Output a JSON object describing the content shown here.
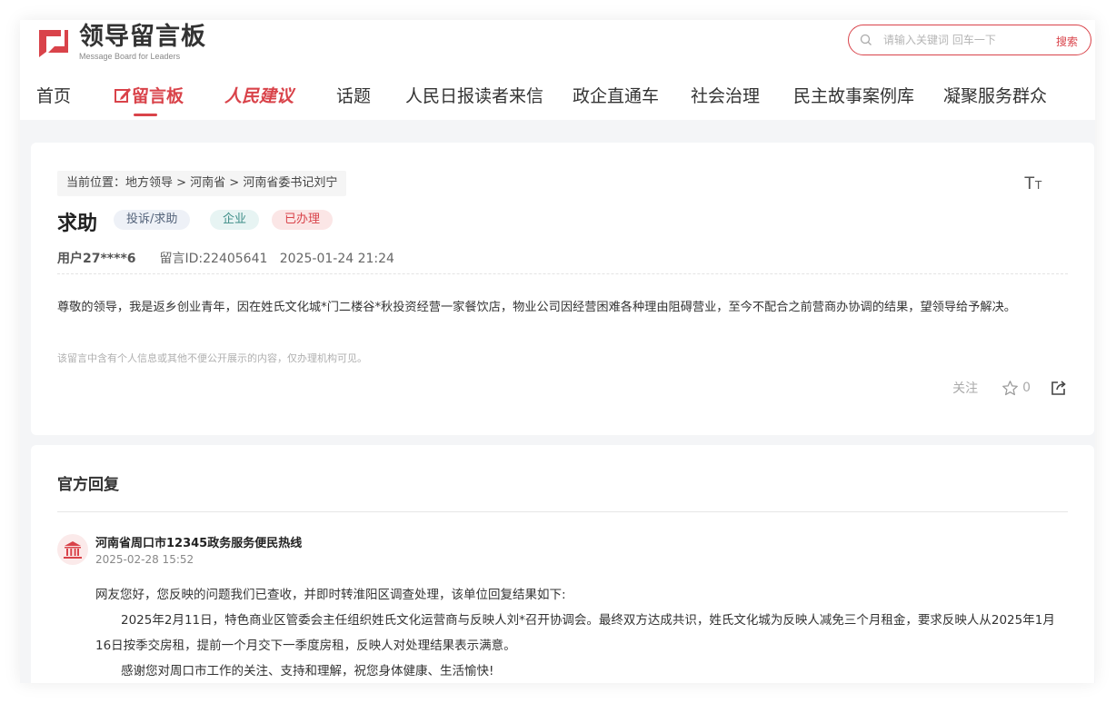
{
  "header": {
    "logo_title": "领导留言板",
    "logo_subtitle": "Message Board for Leaders",
    "search": {
      "placeholder": "请输入关键词 回车一下",
      "button": "搜索"
    },
    "nav": [
      {
        "label": "首页"
      },
      {
        "label": "留言板",
        "active": true
      },
      {
        "label": "人民建议"
      },
      {
        "label": "话题"
      },
      {
        "label": "人民日报读者来信"
      },
      {
        "label": "政企直通车"
      },
      {
        "label": "社会治理"
      },
      {
        "label": "民主故事案例库"
      },
      {
        "label": "凝聚服务群众"
      }
    ]
  },
  "message": {
    "breadcrumb": "当前位置：地方领导 > 河南省 > 河南省委书记刘宁",
    "font_toggle": "TT",
    "title": "求助",
    "tags": [
      "投诉/求助",
      "企业",
      "已办理"
    ],
    "user": "用户27****6",
    "message_id": "留言ID:22405641",
    "datetime": "2025-01-24 21:24",
    "content": "尊敬的领导，我是返乡创业青年，因在姓氏文化城*门二楼谷*秋投资经营一家餐饮店，物业公司因经营困难各种理由阻碍营业，至今不配合之前营商办协调的结果，望领导给予解决。",
    "privacy_note": "该留言中含有个人信息或其他不便公开展示的内容，仅办理机构可见。",
    "follow": "关注",
    "likes": "0"
  },
  "reply": {
    "section_title": "官方回复",
    "org": "河南省周口市12345政务服务便民热线",
    "date": "2025-02-28 15:52",
    "paragraphs": [
      "网友您好，您反映的问题我们已查收，并即时转淮阳区调查处理，该单位回复结果如下:",
      "2025年2月11日，特色商业区管委会主任组织姓氏文化运营商与反映人刘*召开协调会。最终双方达成共识，姓氏文化城为反映人减免三个月租金，要求反映人从2025年1月16日按季交房租，提前一个月交下一季度房租，反映人对处理结果表示满意。",
      "感谢您对周口市工作的关注、支持和理解，祝您身体健康、生活愉快!"
    ]
  },
  "colors": {
    "brand_red": "#d9434a",
    "tag_gray_bg": "#eef1f7",
    "tag_teal_bg": "#e7f4f3",
    "tag_red_bg": "#fbe6e6"
  }
}
